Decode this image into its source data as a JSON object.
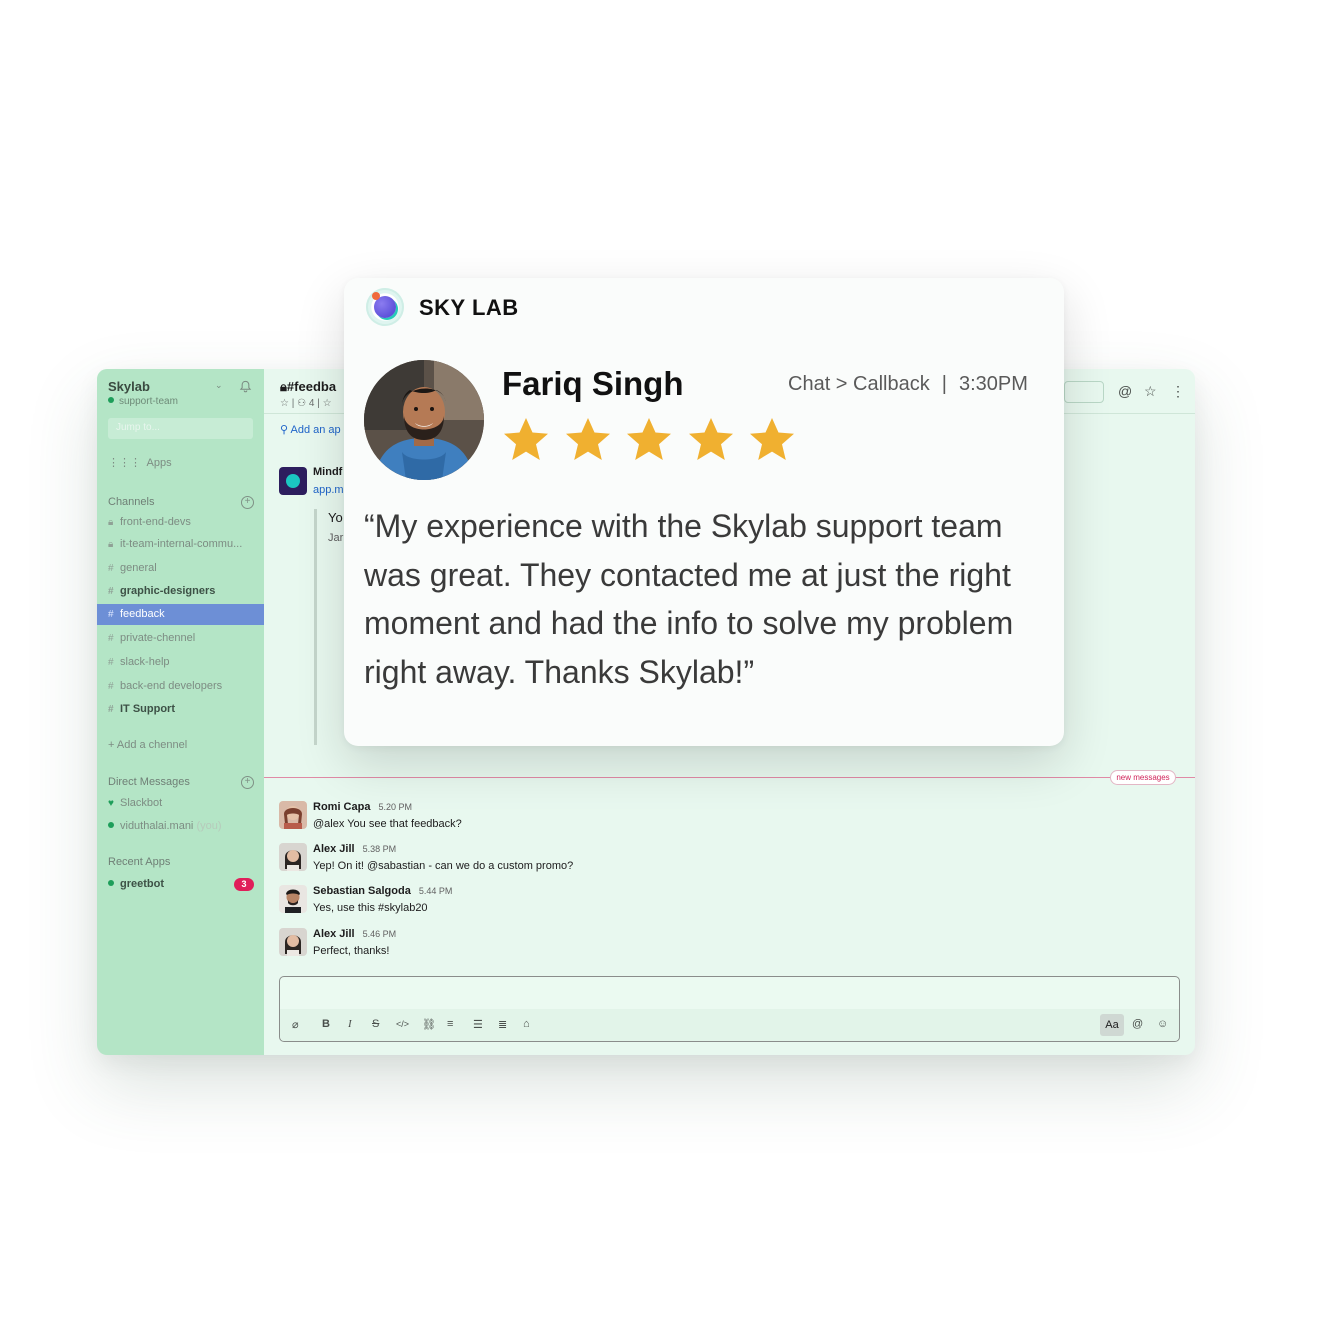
{
  "slack": {
    "workspace": "Skylab",
    "status": "support-team",
    "jump_placeholder": "Jump to...",
    "apps_label": "Apps",
    "channels_header": "Channels",
    "channels": [
      {
        "prefix": "lock",
        "name": "front-end-devs",
        "bold": false,
        "active": false
      },
      {
        "prefix": "lock",
        "name": "it-team-internal-commu...",
        "bold": false,
        "active": false
      },
      {
        "prefix": "#",
        "name": "general",
        "bold": false,
        "active": false
      },
      {
        "prefix": "#",
        "name": "graphic-designers",
        "bold": true,
        "active": false
      },
      {
        "prefix": "#",
        "name": "feedback",
        "bold": false,
        "active": true
      },
      {
        "prefix": "#",
        "name": "private-chennel",
        "bold": false,
        "active": false
      },
      {
        "prefix": "#",
        "name": "slack-help",
        "bold": false,
        "active": false
      },
      {
        "prefix": "#",
        "name": "back-end developers",
        "bold": false,
        "active": false
      },
      {
        "prefix": "#",
        "name": "IT Support",
        "bold": true,
        "active": false
      }
    ],
    "add_channel": "+ Add a chennel",
    "dm_header": "Direct Messages",
    "dms": [
      {
        "name": "Slackbot",
        "suffix": ""
      },
      {
        "name": "viduthalai.mani",
        "suffix": "(you)"
      }
    ],
    "recent_apps_header": "Recent Apps",
    "recent_apps": [
      {
        "name": "greetbot",
        "badge": "3"
      }
    ],
    "channel_title": "#feedba",
    "channel_meta": "☆ | ⚇ 4 | ☆",
    "add_app": "Add an ap",
    "app_message": {
      "name": "Mindf",
      "link": "app.m",
      "line1": "Yo",
      "line2": "Jar"
    },
    "new_messages": "new messages",
    "messages": [
      {
        "author": "Romi Capa",
        "time": "5.20 PM",
        "text": "@alex You see that feedback?"
      },
      {
        "author": "Alex Jill",
        "time": "5.38 PM",
        "text": "Yep! On it! @sabastian - can we do a custom promo?"
      },
      {
        "author": "Sebastian Salgoda",
        "time": "5.44 PM",
        "text": "Yes, use this #skylab20"
      },
      {
        "author": "Alex Jill",
        "time": "5.46 PM",
        "text": "Perfect, thanks!"
      }
    ],
    "composer": {
      "aa": "Aa"
    }
  },
  "card": {
    "brand": "SKY LAB",
    "reviewer": "Fariq Singh",
    "route": "Chat > Callback",
    "time": "3:30PM",
    "rating": 5,
    "rating_max": 5,
    "star_color": "#f0b030",
    "quote": "“My experience with the Skylab support team was great. They contacted me at just the right moment and had the info to solve my problem right away. Thanks Skylab!”"
  }
}
